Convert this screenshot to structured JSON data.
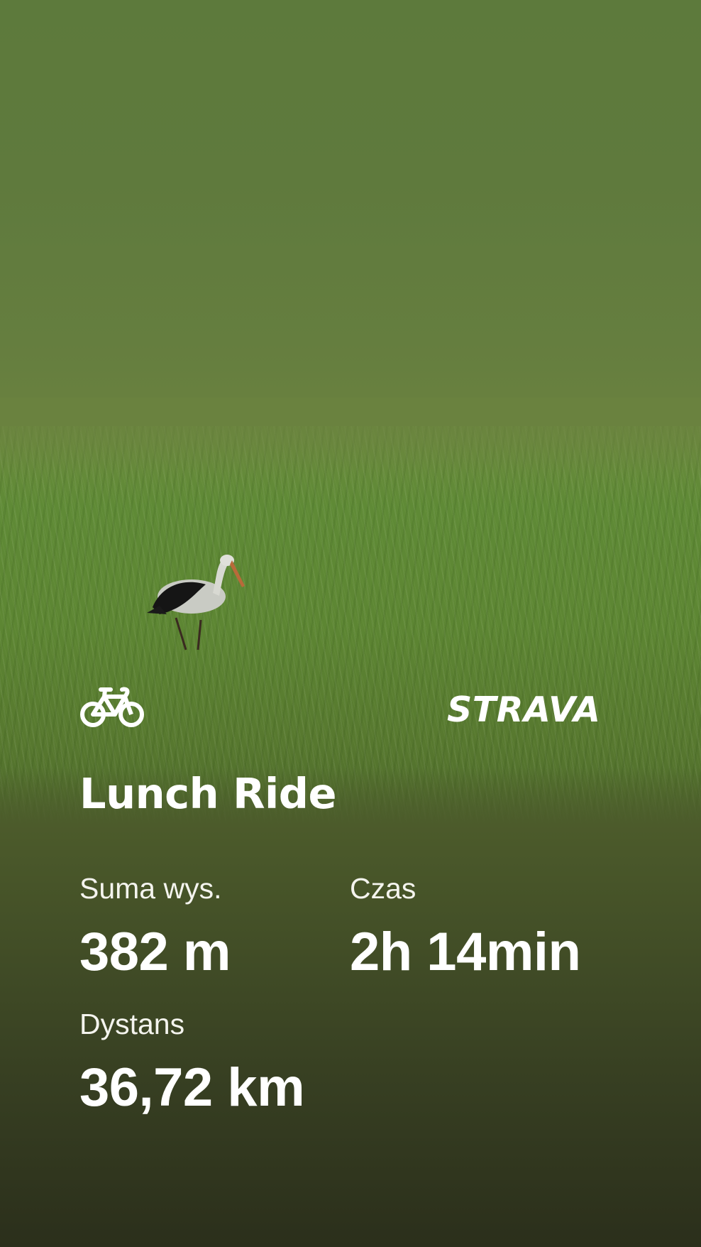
{
  "activity": {
    "type_icon": "bicycle-icon",
    "title": "Lunch Ride",
    "brand": "STRAVA"
  },
  "stats": {
    "elevation": {
      "label": "Suma wys.",
      "value": "382 m"
    },
    "time": {
      "label": "Czas",
      "value": "2h 14min"
    },
    "distance": {
      "label": "Dystans",
      "value": "36,72 km"
    }
  },
  "colors": {
    "sky": "#5f7a3d",
    "grass": "#5d8633",
    "shade": "#2b2f1b",
    "text": "#ffffff"
  }
}
